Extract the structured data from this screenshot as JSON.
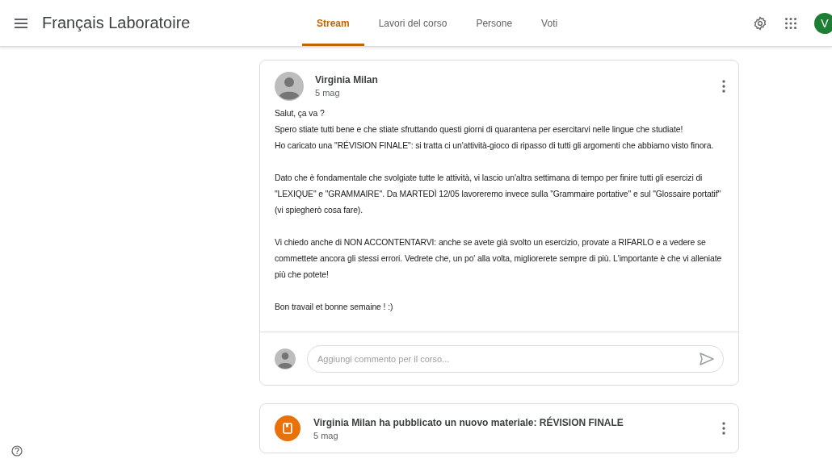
{
  "header": {
    "title": "Français Laboratoire",
    "tabs": [
      {
        "label": "Stream",
        "selected": true
      },
      {
        "label": "Lavori del corso",
        "selected": false
      },
      {
        "label": "Persone",
        "selected": false
      },
      {
        "label": "Voti",
        "selected": false
      }
    ],
    "avatar_letter": "V"
  },
  "post": {
    "author": "Virginia Milan",
    "date": "5 mag",
    "paragraphs": [
      {
        "lines": [
          "Salut, ça va ?",
          "Spero stiate tutti bene e che stiate sfruttando questi giorni di quarantena per esercitarvi nelle lingue che studiate!",
          "Ho caricato una \"RÉVISION FINALE\": si tratta ci un'attività-gioco di ripasso di tutti gli argomenti che abbiamo visto finora."
        ]
      },
      {
        "lines": [
          "Dato che è fondamentale che svolgiate tutte le attività, vi lascio un'altra settimana di tempo per finire tutti gli esercizi di \"LEXIQUE\" e \"GRAMMAIRE\". Da MARTEDÌ 12/05 lavoreremo invece sulla \"Grammaire portative\" e sul \"Glossaire portatif\" (vi spiegherò cosa fare)."
        ]
      },
      {
        "lines": [
          "Vi chiedo anche di NON ACCONTENTARVI: anche se avete già svolto un esercizio, provate a RIFARLO e a vedere se commettete ancora gli stessi errori. Vedrete che, un po' alla volta, migliorerete sempre di più. L'importante è che vi alleniate più che potete!"
        ]
      },
      {
        "lines": [
          "Bon travail et bonne semaine ! :)"
        ]
      }
    ],
    "comment": {
      "placeholder": "Aggiungi commento per il corso..."
    }
  },
  "material": {
    "title": "Virginia Milan ha pubblicato un nuovo materiale: RÉVISION FINALE",
    "date": "5 mag"
  }
}
